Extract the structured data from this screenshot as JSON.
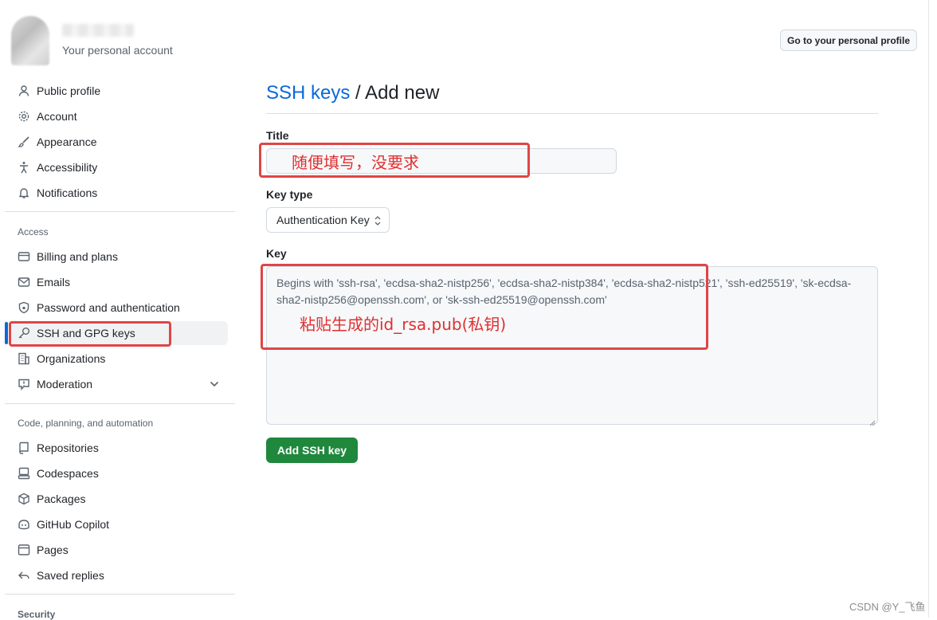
{
  "account": {
    "subtitle": "Your personal account",
    "profile_button": "Go to your personal profile"
  },
  "sidebar": {
    "group1": [
      {
        "label": "Public profile",
        "icon": "person-icon"
      },
      {
        "label": "Account",
        "icon": "gear-icon"
      },
      {
        "label": "Appearance",
        "icon": "paintbrush-icon"
      },
      {
        "label": "Accessibility",
        "icon": "accessibility-icon"
      },
      {
        "label": "Notifications",
        "icon": "bell-icon"
      }
    ],
    "access_label": "Access",
    "group2": [
      {
        "label": "Billing and plans",
        "icon": "credit-card-icon"
      },
      {
        "label": "Emails",
        "icon": "mail-icon"
      },
      {
        "label": "Password and authentication",
        "icon": "shield-lock-icon"
      },
      {
        "label": "SSH and GPG keys",
        "icon": "key-icon",
        "active": true
      },
      {
        "label": "Organizations",
        "icon": "organization-icon"
      },
      {
        "label": "Moderation",
        "icon": "report-icon"
      }
    ],
    "code_label": "Code, planning, and automation",
    "group3": [
      {
        "label": "Repositories",
        "icon": "repo-icon"
      },
      {
        "label": "Codespaces",
        "icon": "codespaces-icon"
      },
      {
        "label": "Packages",
        "icon": "package-icon"
      },
      {
        "label": "GitHub Copilot",
        "icon": "copilot-icon"
      },
      {
        "label": "Pages",
        "icon": "browser-icon"
      },
      {
        "label": "Saved replies",
        "icon": "reply-icon"
      }
    ],
    "security_label": "Security"
  },
  "main": {
    "breadcrumb_link": "SSH keys",
    "breadcrumb_rest": " / Add new",
    "title_label": "Title",
    "key_type_label": "Key type",
    "key_type_value": "Authentication Key",
    "key_label": "Key",
    "key_placeholder": "Begins with 'ssh-rsa', 'ecdsa-sha2-nistp256', 'ecdsa-sha2-nistp384', 'ecdsa-sha2-nistp521', 'ssh-ed25519', 'sk-ecdsa-sha2-nistp256@openssh.com', or 'sk-ssh-ed25519@openssh.com'",
    "add_button": "Add SSH key"
  },
  "annotations": {
    "title_note": "随便填写，没要求",
    "key_note": "粘贴生成的id_rsa.pub(私钥)"
  },
  "watermark": "CSDN @Y_飞鱼",
  "colors": {
    "accent": "#0969da",
    "primary_button": "#1f883d",
    "annotation_red": "#e04545"
  }
}
